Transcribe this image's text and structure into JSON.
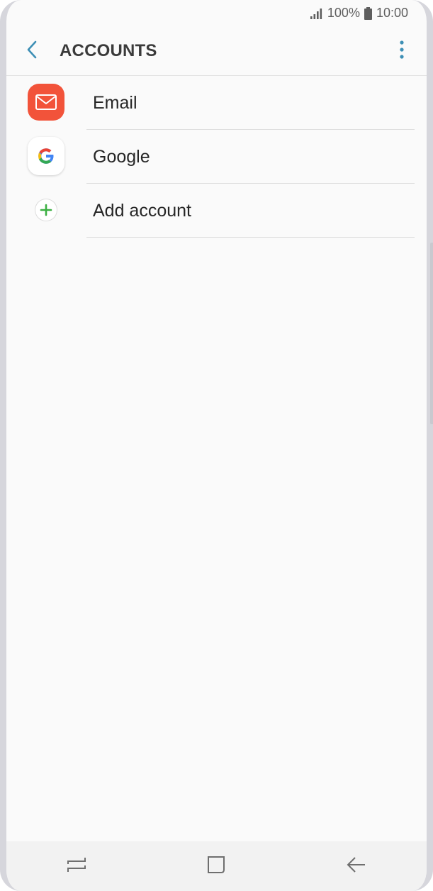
{
  "status_bar": {
    "battery_percent": "100%",
    "time": "10:00",
    "signal_icon": "signal-bars-icon",
    "battery_icon": "battery-full-icon"
  },
  "header": {
    "title": "ACCOUNTS",
    "back_icon": "chevron-left-icon",
    "menu_icon": "more-vertical-icon"
  },
  "accounts": [
    {
      "label": "Email",
      "icon": "email-envelope-icon",
      "icon_color": "#f2533a"
    },
    {
      "label": "Google",
      "icon": "google-g-icon"
    },
    {
      "label": "Add account",
      "icon": "plus-circle-icon",
      "icon_color": "#3cb043"
    }
  ],
  "nav_bar": {
    "recents_icon": "recents-icon",
    "home_icon": "home-icon",
    "back_icon": "back-arrow-icon"
  },
  "colors": {
    "accent": "#3d8fb5",
    "background": "#fafafa",
    "text": "#262626"
  }
}
